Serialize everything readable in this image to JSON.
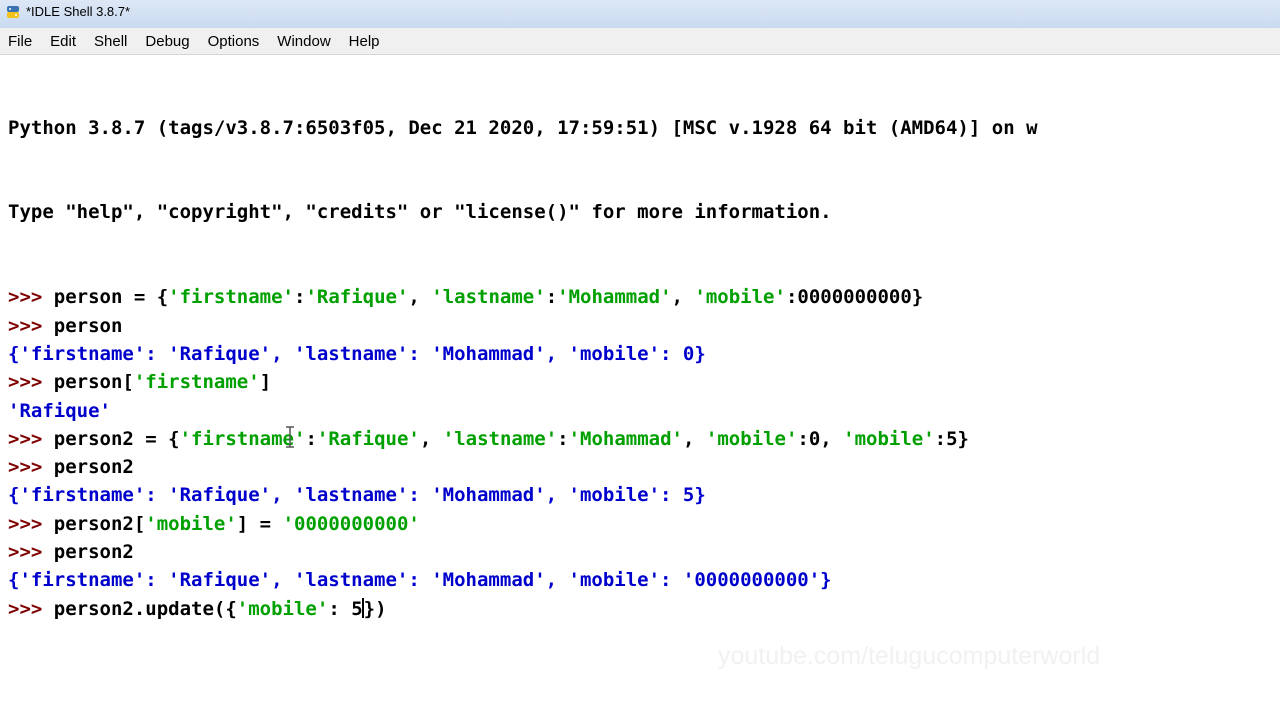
{
  "window": {
    "title": "*IDLE Shell 3.8.7*"
  },
  "menu": {
    "items": [
      "File",
      "Edit",
      "Shell",
      "Debug",
      "Options",
      "Window",
      "Help"
    ]
  },
  "shell": {
    "banner": [
      "Python 3.8.7 (tags/v3.8.7:6503f05, Dec 21 2020, 17:59:51) [MSC v.1928 64 bit (AMD64)] on w",
      "Type \"help\", \"copyright\", \"credits\" or \"license()\" for more information."
    ],
    "prompt": ">>> ",
    "lines": [
      {
        "type": "input",
        "segments": [
          {
            "kind": "code",
            "text": "person = {"
          },
          {
            "kind": "string",
            "text": "'firstname'"
          },
          {
            "kind": "code",
            "text": ":"
          },
          {
            "kind": "string",
            "text": "'Rafique'"
          },
          {
            "kind": "code",
            "text": ", "
          },
          {
            "kind": "string",
            "text": "'lastname'"
          },
          {
            "kind": "code",
            "text": ":"
          },
          {
            "kind": "string",
            "text": "'Mohammad'"
          },
          {
            "kind": "code",
            "text": ", "
          },
          {
            "kind": "string",
            "text": "'mobile'"
          },
          {
            "kind": "code",
            "text": ":0000000000}"
          }
        ]
      },
      {
        "type": "input",
        "segments": [
          {
            "kind": "code",
            "text": "person"
          }
        ]
      },
      {
        "type": "output",
        "text": "{'firstname': 'Rafique', 'lastname': 'Mohammad', 'mobile': 0}"
      },
      {
        "type": "input",
        "segments": [
          {
            "kind": "code",
            "text": "person["
          },
          {
            "kind": "string",
            "text": "'firstname'"
          },
          {
            "kind": "code",
            "text": "]"
          }
        ]
      },
      {
        "type": "output",
        "text": "'Rafique'"
      },
      {
        "type": "input",
        "segments": [
          {
            "kind": "code",
            "text": "person2 = {"
          },
          {
            "kind": "string",
            "text": "'firstname'"
          },
          {
            "kind": "code",
            "text": ":"
          },
          {
            "kind": "string",
            "text": "'Rafique'"
          },
          {
            "kind": "code",
            "text": ", "
          },
          {
            "kind": "string",
            "text": "'lastname'"
          },
          {
            "kind": "code",
            "text": ":"
          },
          {
            "kind": "string",
            "text": "'Mohammad'"
          },
          {
            "kind": "code",
            "text": ", "
          },
          {
            "kind": "string",
            "text": "'mobile'"
          },
          {
            "kind": "code",
            "text": ":0, "
          },
          {
            "kind": "string",
            "text": "'mobile'"
          },
          {
            "kind": "code",
            "text": ":5}"
          }
        ]
      },
      {
        "type": "input",
        "segments": [
          {
            "kind": "code",
            "text": "person2"
          }
        ]
      },
      {
        "type": "output",
        "text": "{'firstname': 'Rafique', 'lastname': 'Mohammad', 'mobile': 5}"
      },
      {
        "type": "input",
        "segments": [
          {
            "kind": "code",
            "text": "person2["
          },
          {
            "kind": "string",
            "text": "'mobile'"
          },
          {
            "kind": "code",
            "text": "] = "
          },
          {
            "kind": "string",
            "text": "'0000000000'"
          }
        ]
      },
      {
        "type": "input",
        "segments": [
          {
            "kind": "code",
            "text": "person2"
          }
        ]
      },
      {
        "type": "output",
        "text": "{'firstname': 'Rafique', 'lastname': 'Mohammad', 'mobile': '0000000000'}"
      },
      {
        "type": "input",
        "current": true,
        "segments": [
          {
            "kind": "code",
            "text": "person2.update({"
          },
          {
            "kind": "string",
            "text": "'mobile'"
          },
          {
            "kind": "code",
            "text": ": 5"
          },
          {
            "kind": "cursor",
            "text": ""
          },
          {
            "kind": "code",
            "text": "})"
          }
        ]
      }
    ]
  },
  "watermark": "youtube.com/telugucomputerworld",
  "colors": {
    "prompt": "#7f0000",
    "string": "#00a000",
    "output": "#0000cc",
    "code": "#000000"
  }
}
